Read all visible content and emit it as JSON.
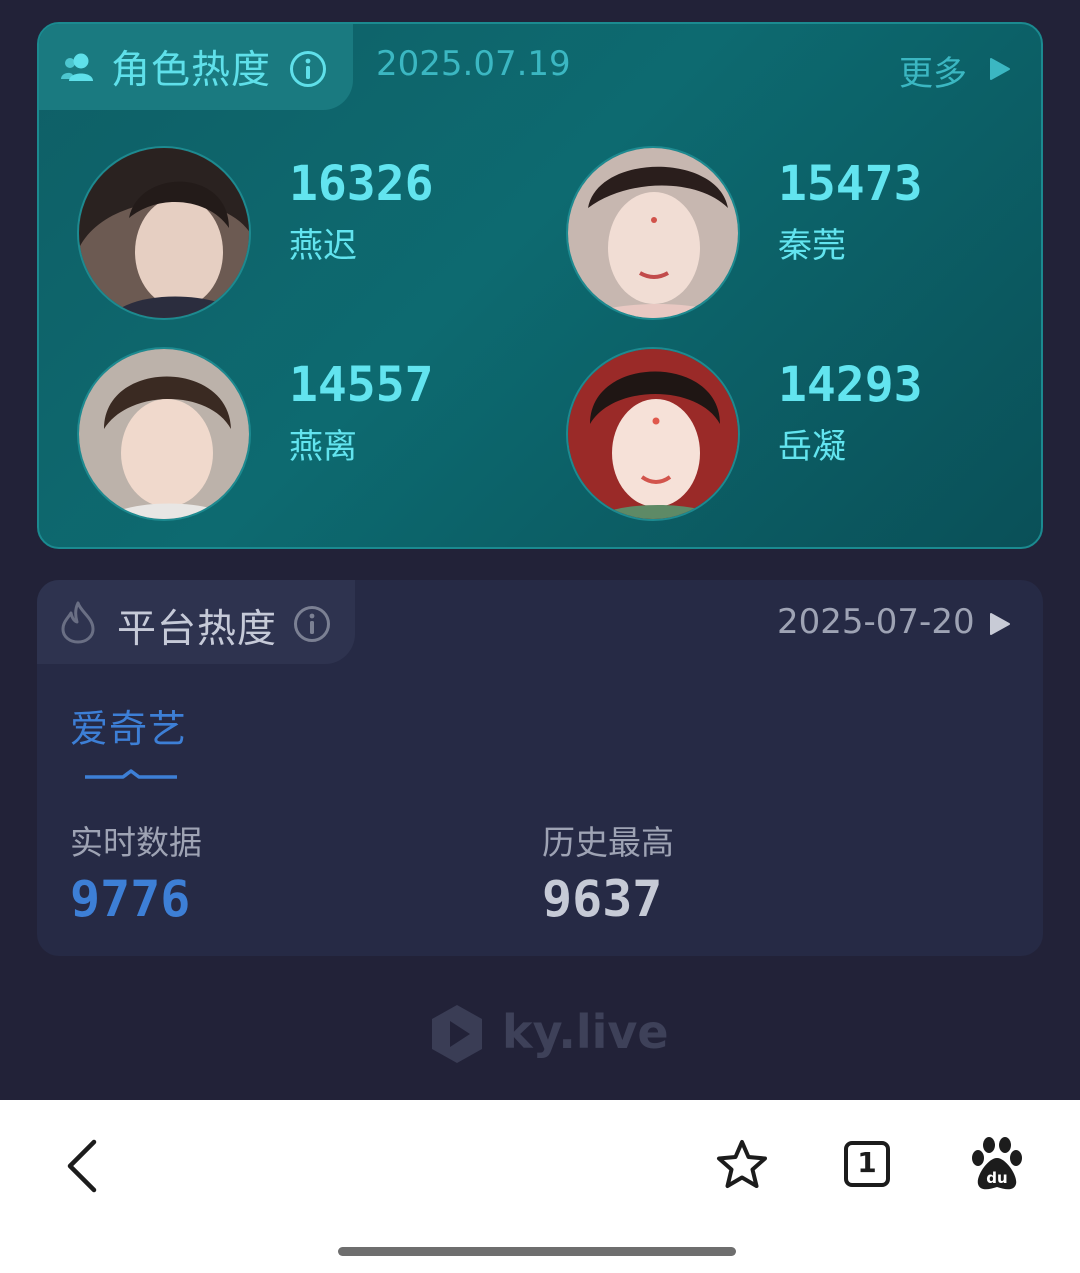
{
  "character_heat": {
    "title": "角色热度",
    "date": "2025.07.19",
    "more_label": "更多",
    "items": [
      {
        "score": "16326",
        "name": "燕迟",
        "avatar": "male-character-avatar"
      },
      {
        "score": "15473",
        "name": "秦莞",
        "avatar": "female-character-avatar"
      },
      {
        "score": "14557",
        "name": "燕离",
        "avatar": "male-character-avatar"
      },
      {
        "score": "14293",
        "name": "岳凝",
        "avatar": "female-character-avatar"
      }
    ]
  },
  "platform_heat": {
    "title": "平台热度",
    "date": "2025-07-20",
    "tab_label": "爱奇艺",
    "realtime_label": "实时数据",
    "realtime_value": "9776",
    "history_label": "历史最高",
    "history_value": "9637"
  },
  "watermark": {
    "text": "ky.live"
  },
  "browser_bar": {
    "tab_count": "1",
    "buttons": [
      "back-icon",
      "star-icon",
      "tabs-icon",
      "baidu-paw-icon"
    ]
  },
  "colors": {
    "accent_cyan": "#62e4ef",
    "accent_blue": "#3d7fd6",
    "background": "#222238"
  }
}
